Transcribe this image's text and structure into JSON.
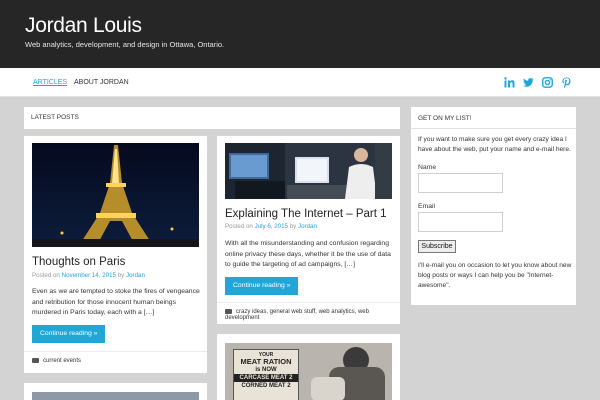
{
  "site": {
    "title": "Jordan Louis",
    "description": "Web analytics, development, and design in Ottawa, Ontario."
  },
  "nav": {
    "items": [
      {
        "label": "ARTICLES",
        "active": true
      },
      {
        "label": "ABOUT JORDAN",
        "active": false
      }
    ],
    "social_icons": [
      "linkedin-icon",
      "twitter-icon",
      "instagram-icon",
      "pinterest-icon"
    ],
    "accent_color": "#1fa7d8"
  },
  "section_title": "LATEST POSTS",
  "posts": [
    {
      "title": "Thoughts on Paris",
      "posted_on_prefix": "Posted on",
      "date": "November 14, 2015",
      "by": "by",
      "author": "Jordan",
      "excerpt": "Even as we are tempted to stoke the fires of vengeance and retribution for those innocent human beings murdered in Paris today, each with a […]",
      "button": "Continue reading »",
      "categories": "current events"
    },
    {
      "title": "Explaining The Internet – Part 1",
      "posted_on_prefix": "Posted on",
      "date": "July 6, 2015",
      "by": "by",
      "author": "Jordan",
      "excerpt": "With all the misunderstanding and confusion regarding online privacy these days, whether it be the use of data to guide the targeting of ad campaigns, […]",
      "button": "Continue reading »",
      "categories": "crazy ideas, general web stuff, web analytics, web development"
    },
    {
      "poster_lines": [
        "YOUR",
        "MEAT RATION",
        "is NOW",
        "CARCASE MEAT 2",
        "CORNED MEAT 2"
      ]
    }
  ],
  "widget": {
    "title": "GET ON MY LIST!",
    "intro": "If you want to make sure you get every crazy idea I have about the web, put your name and e-mail here.",
    "name_label": "Name",
    "email_label": "Email",
    "subscribe_label": "Subscribe",
    "outro": "I'll e-mail you on occasion to let you know about new blog posts or ways I can help you be \"Internet-awesome\"."
  }
}
